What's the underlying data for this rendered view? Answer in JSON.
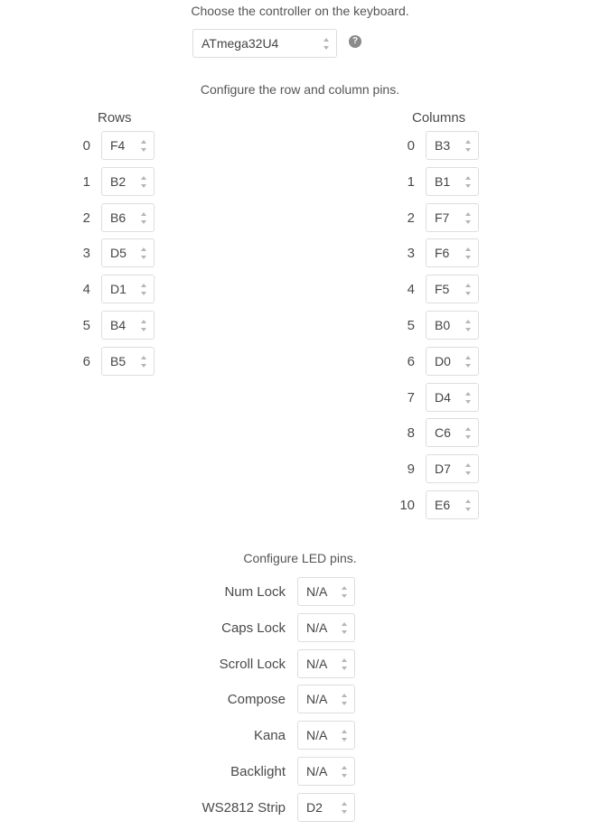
{
  "controller": {
    "caption": "Choose the controller on the keyboard.",
    "selected": "ATmega32U4",
    "help_glyph": "?",
    "help_icon": "question-circle-icon"
  },
  "pins": {
    "caption": "Configure the row and column pins.",
    "rows_heading": "Rows",
    "columns_heading": "Columns",
    "rows": [
      {
        "index": "0",
        "pin": "F4"
      },
      {
        "index": "1",
        "pin": "B2"
      },
      {
        "index": "2",
        "pin": "B6"
      },
      {
        "index": "3",
        "pin": "D5"
      },
      {
        "index": "4",
        "pin": "D1"
      },
      {
        "index": "5",
        "pin": "B4"
      },
      {
        "index": "6",
        "pin": "B5"
      }
    ],
    "columns": [
      {
        "index": "0",
        "pin": "B3"
      },
      {
        "index": "1",
        "pin": "B1"
      },
      {
        "index": "2",
        "pin": "F7"
      },
      {
        "index": "3",
        "pin": "F6"
      },
      {
        "index": "4",
        "pin": "F5"
      },
      {
        "index": "5",
        "pin": "B0"
      },
      {
        "index": "6",
        "pin": "D0"
      },
      {
        "index": "7",
        "pin": "D4"
      },
      {
        "index": "8",
        "pin": "C6"
      },
      {
        "index": "9",
        "pin": "D7"
      },
      {
        "index": "10",
        "pin": "E6"
      }
    ]
  },
  "leds": {
    "caption": "Configure LED pins.",
    "items": [
      {
        "label": "Num Lock",
        "value": "N/A"
      },
      {
        "label": "Caps Lock",
        "value": "N/A"
      },
      {
        "label": "Scroll Lock",
        "value": "N/A"
      },
      {
        "label": "Compose",
        "value": "N/A"
      },
      {
        "label": "Kana",
        "value": "N/A"
      },
      {
        "label": "Backlight",
        "value": "N/A"
      },
      {
        "label": "WS2812 Strip",
        "value": "D2"
      }
    ]
  },
  "colors": {
    "text": "#555555",
    "select_border": "#dddddd",
    "help_icon": "#8a8a8a"
  }
}
